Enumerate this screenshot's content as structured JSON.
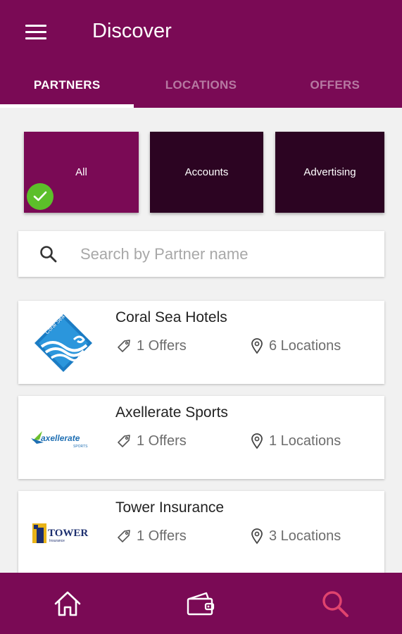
{
  "header": {
    "title": "Discover"
  },
  "tabs": [
    {
      "label": "PARTNERS",
      "active": true
    },
    {
      "label": "LOCATIONS",
      "active": false
    },
    {
      "label": "OFFERS",
      "active": false
    }
  ],
  "categories": [
    {
      "label": "All",
      "selected": true
    },
    {
      "label": "Accounts",
      "selected": false
    },
    {
      "label": "Advertising",
      "selected": false
    }
  ],
  "search": {
    "placeholder": "Search by Partner name",
    "value": ""
  },
  "partners": [
    {
      "name": "Coral Sea Hotels",
      "offers": "1 Offers",
      "locations": "6 Locations",
      "logo": "coral-sea-hotels-logo"
    },
    {
      "name": "Axellerate Sports",
      "offers": "1 Offers",
      "locations": "1 Locations",
      "logo": "axellerate-sports-logo"
    },
    {
      "name": "Tower Insurance",
      "offers": "1 Offers",
      "locations": "3 Locations",
      "logo": "tower-insurance-logo"
    }
  ],
  "logos": {
    "coral_sea_text": "Coral Sea Hotels",
    "axellerate_text": "axellerate",
    "axellerate_sub": "SPORTS",
    "tower_text": "TOWER",
    "tower_sub": "Insurance"
  },
  "bottom_nav": [
    {
      "icon": "home-icon",
      "active": false
    },
    {
      "icon": "wallet-icon",
      "active": false
    },
    {
      "icon": "search-icon",
      "active": true
    }
  ],
  "colors": {
    "primary": "#7a0a55",
    "tile_dark": "#2c0422",
    "check_green": "#5cbf2a",
    "nav_active": "#e0436e"
  }
}
